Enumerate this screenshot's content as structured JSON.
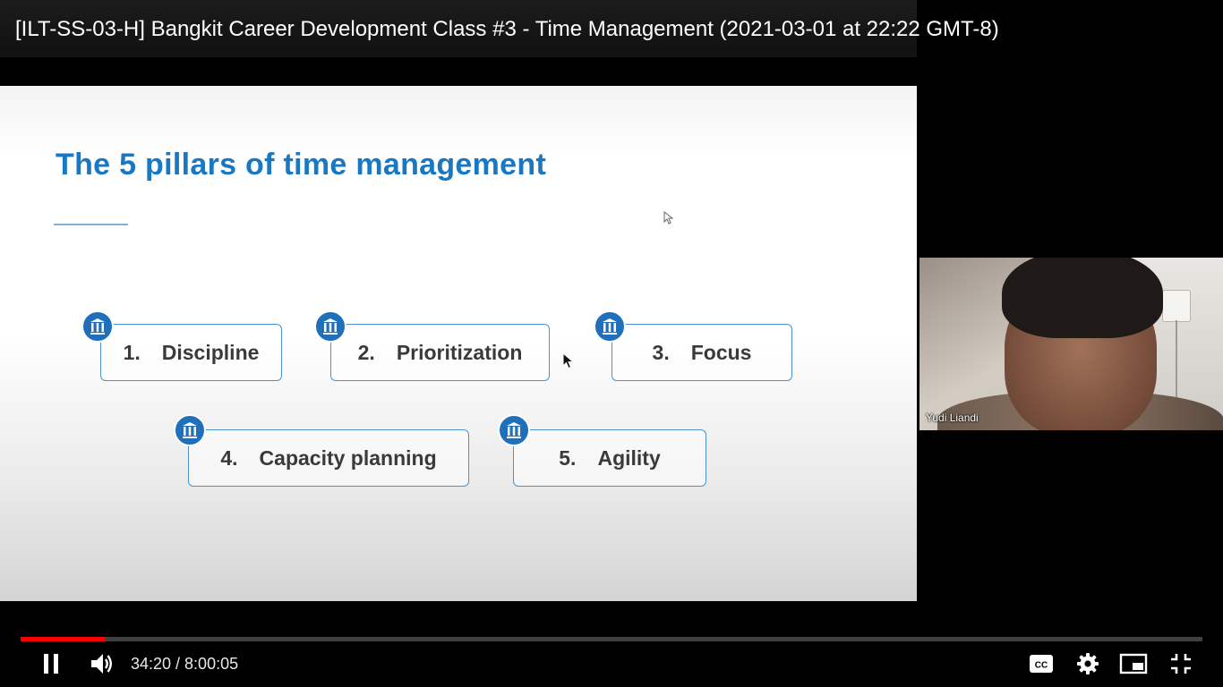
{
  "video": {
    "title": "[ILT-SS-03-H] Bangkit Career Development Class #3 - Time Management (2021-03-01 at 22:22 GMT-8)"
  },
  "slide": {
    "title": "The 5 pillars of time management",
    "pillars": [
      {
        "num": "1.",
        "label": "Discipline",
        "icon": "pillar-icon"
      },
      {
        "num": "2.",
        "label": "Prioritization",
        "icon": "pillar-icon"
      },
      {
        "num": "3.",
        "label": "Focus",
        "icon": "pillar-icon"
      },
      {
        "num": "4.",
        "label": "Capacity planning",
        "icon": "pillar-icon"
      },
      {
        "num": "5.",
        "label": "Agility",
        "icon": "pillar-icon"
      }
    ],
    "colors": {
      "title": "#1a78c2",
      "badge": "#1f6fba",
      "border": "#4a93d0"
    }
  },
  "participant": {
    "name": "Yudi Liandi"
  },
  "player": {
    "current_time": "34:20",
    "duration": "8:00:05",
    "time_display": "34:20 / 8:00:05",
    "progress_fraction": 0.0715,
    "progress_color": "#ff0000",
    "icons": [
      "pause-icon",
      "volume-icon",
      "captions-icon",
      "settings-icon",
      "miniplayer-icon",
      "exit-fullscreen-icon"
    ]
  }
}
